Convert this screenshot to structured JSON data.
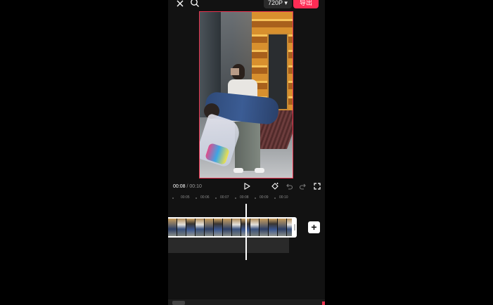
{
  "topbar": {
    "resolution_label": "720P ▾",
    "export_label": "导出"
  },
  "playback": {
    "current_time": "00:08",
    "separator": " / ",
    "total_time": "00:10"
  },
  "ruler": {
    "ticks": [
      "00:05",
      "00:06",
      "00:07",
      "00:08",
      "00:09",
      "00:10"
    ]
  },
  "timeline": {
    "add_label": "+"
  },
  "colors": {
    "accent": "#fe2c55",
    "background": "#121212",
    "preview_border": "#e8324e"
  },
  "icons": [
    "close-icon",
    "search-icon",
    "play-icon",
    "keyframe-icon",
    "undo-icon",
    "redo-icon",
    "fullscreen-icon"
  ]
}
